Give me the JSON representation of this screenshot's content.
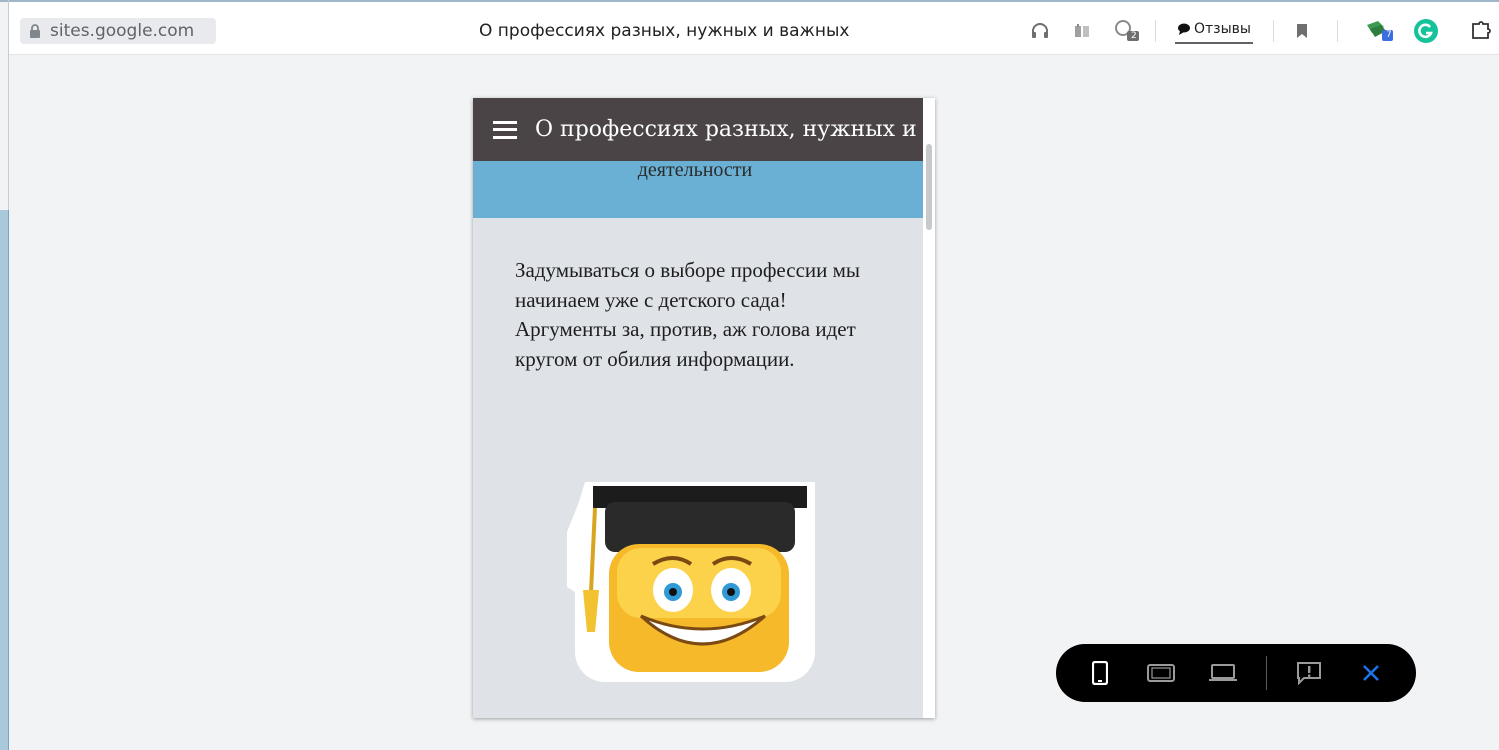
{
  "browser": {
    "url": "sites.google.com",
    "page_title": "О профессиях разных, нужных и важных",
    "reviews_label": "Отзывы",
    "comments_badge": "2",
    "extension_badge": "7"
  },
  "site": {
    "header_title": "О профессиях разных, нужных и",
    "banner_text": "деятельности",
    "intro_paragraph": "Задумываться о выборе профессии мы начинаем уже с детского сада!    Аргументы за, против, аж голова идет кругом от обилия информации."
  },
  "icons": {
    "lock": "lock-icon",
    "headphones": "headphones-icon",
    "reader": "reader-icon",
    "comments": "comments-icon",
    "bookmark": "bookmark-icon",
    "extension": "extension-icon",
    "grammarly": "grammarly-icon",
    "puzzle": "puzzle-icon",
    "menu": "hamburger-icon",
    "mobile": "phone-view-icon",
    "tablet": "tablet-view-icon",
    "desktop": "desktop-view-icon",
    "feedback": "feedback-icon",
    "close": "close-icon"
  },
  "colors": {
    "site_header": "#4a4447",
    "banner": "#6ab0d4",
    "content_bg": "#dfe3e8",
    "close_accent": "#1a73e8",
    "grammarly": "#15c39a"
  }
}
